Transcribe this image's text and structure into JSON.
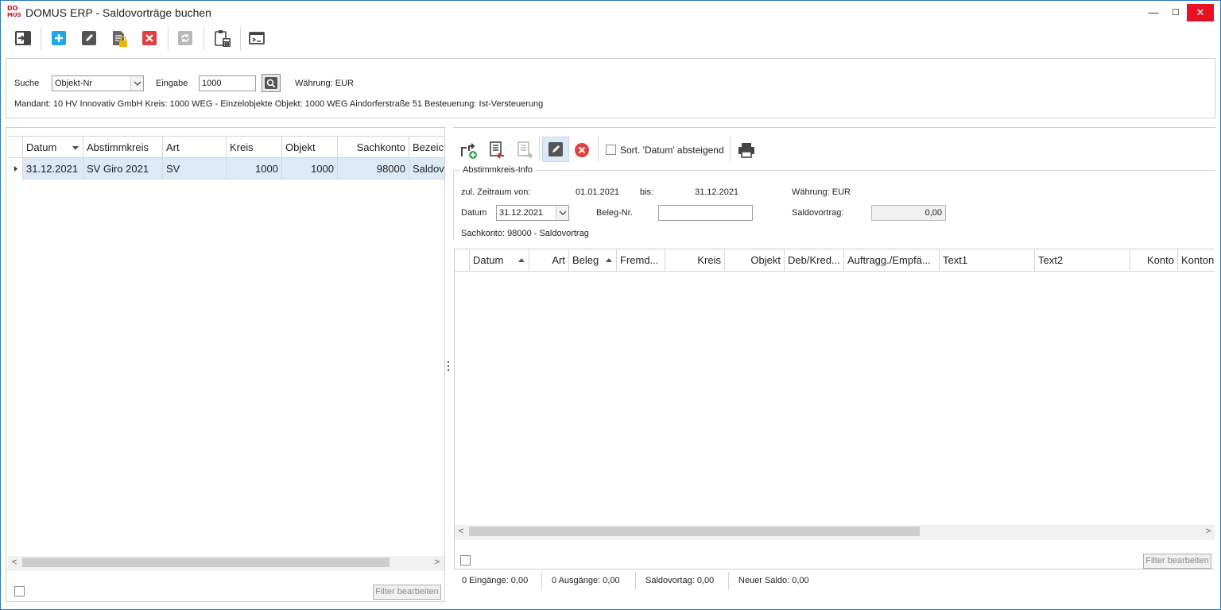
{
  "window": {
    "title": "DOMUS ERP - Saldovorträge buchen",
    "logo_top": "DO",
    "logo_bottom": "MUS",
    "minimize": "—",
    "maximize": "☐",
    "close": "✕"
  },
  "colors": {
    "accent": "#2b7bbf",
    "add": "#1fa6e6",
    "delete": "#e04040",
    "selected_row": "#dce9f7",
    "lock": "#f2b400"
  },
  "toolbar": {
    "icons": [
      "exit-icon",
      "add-icon",
      "edit-icon",
      "lock-document-icon",
      "delete-icon",
      "refresh-icon",
      "clipboard-calculator-icon",
      "window-icon"
    ]
  },
  "search": {
    "suche_label": "Suche",
    "suche_value": "Objekt-Nr",
    "eingabe_label": "Eingabe",
    "eingabe_value": "1000",
    "waehrung": "Währung: EUR",
    "info_line": "Mandant: 10 HV Innovativ GmbH  Kreis: 1000 WEG - Einzelobjekte  Objekt: 1000 WEG Aindorferstraße 51  Besteuerung: Ist-Versteuerung"
  },
  "left_grid": {
    "columns": [
      "Datum",
      "Abstimmkreis",
      "Art",
      "Kreis",
      "Objekt",
      "Sachkonto",
      "Bezeichnung"
    ],
    "rows": [
      [
        "31.12.2021",
        "SV Giro 2021",
        "SV",
        "1000",
        "1000",
        "98000",
        "Saldovortrag"
      ]
    ],
    "filter_button": "Filter bearbeiten"
  },
  "right_toolbar": {
    "sort_label": "Sort. 'Datum' absteigend"
  },
  "abstimmkreis_info": {
    "title": "Abstimmkreis-Info",
    "zeitraum_von_label": "zul. Zeitraum von:",
    "zeitraum_von": "01.01.2021",
    "bis_label": "bis:",
    "bis": "31.12.2021",
    "waehrung": "Währung: EUR",
    "datum_label": "Datum",
    "datum_value": "31.12.2021",
    "beleg_label": "Beleg-Nr.",
    "beleg_value": "",
    "saldovortrag_label": "Saldovortrag:",
    "saldovortrag_value": "0,00",
    "sachkonto": "Sachkonto: 98000 - Saldovortrag"
  },
  "right_grid": {
    "columns": [
      "Datum",
      "Art",
      "Beleg",
      "Fremd...",
      "Kreis",
      "Objekt",
      "Deb/Kred...",
      "Auftragg./Empfä...",
      "Text1",
      "Text2",
      "Konto",
      "Konton"
    ],
    "filter_button": "Filter bearbeiten"
  },
  "status": {
    "eingaenge": "0 Eingänge: 0,00",
    "ausgaenge": "0 Ausgänge: 0,00",
    "saldovortag": "Saldovortag: 0,00",
    "neuer_saldo": "Neuer Saldo: 0,00"
  }
}
